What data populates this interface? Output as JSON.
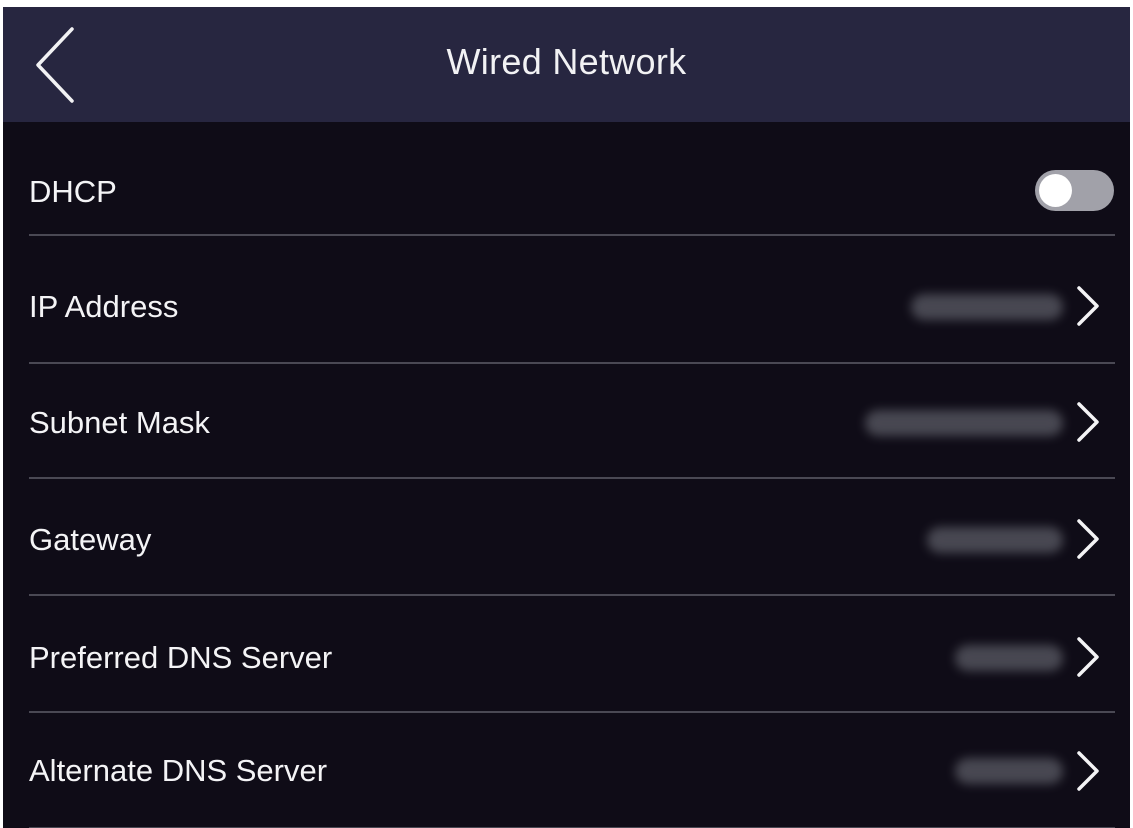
{
  "header": {
    "title": "Wired Network",
    "back_icon": "chevron-left-icon"
  },
  "colors": {
    "background": "#0f0c17",
    "header_background": "#272640",
    "text": "#f4f4f6",
    "divider": "#4a4954",
    "toggle_off": "#a1a1a9"
  },
  "dhcp": {
    "label": "DHCP",
    "enabled": false
  },
  "rows": [
    {
      "label": "IP Address",
      "value_visible": false,
      "icon": "chevron-right-icon"
    },
    {
      "label": "Subnet Mask",
      "value_visible": false,
      "icon": "chevron-right-icon"
    },
    {
      "label": "Gateway",
      "value_visible": false,
      "icon": "chevron-right-icon"
    },
    {
      "label": "Preferred DNS Server",
      "value_visible": false,
      "icon": "chevron-right-icon"
    },
    {
      "label": "Alternate DNS Server",
      "value_visible": false,
      "icon": "chevron-right-icon"
    }
  ]
}
